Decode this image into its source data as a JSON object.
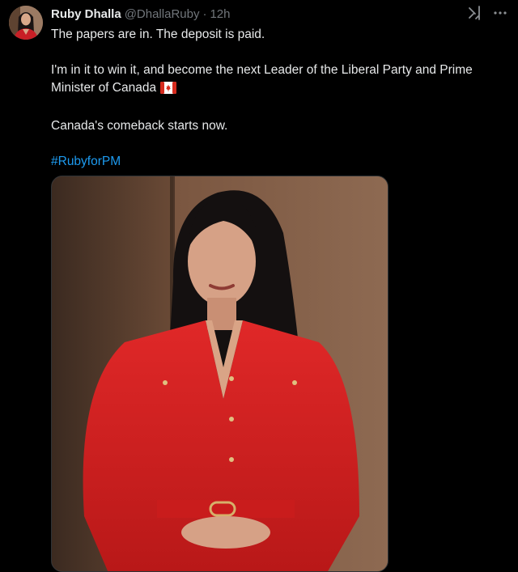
{
  "tweet": {
    "author": {
      "display_name": "Ruby Dhalla",
      "handle": "@DhallaRuby",
      "separator": "·",
      "time": "12h",
      "avatar_icon": "user-avatar"
    },
    "lines": [
      "The papers are in. The deposit is paid.",
      "I'm in it to win it, and become the next Leader of the Liberal Party and Prime Minister of Canada",
      "Canada's comeback starts now."
    ],
    "flag_icon": "canada-flag-emoji",
    "hashtag": "#RubyforPM",
    "top_icons": [
      "grok-icon",
      "more-icon"
    ],
    "media": {
      "type": "photo",
      "icon": "photo-portrait"
    }
  },
  "colors": {
    "background": "#000000",
    "text": "#e7e9ea",
    "muted": "#71767b",
    "link": "#1d9bf0",
    "accent_red": "#d42a2a"
  }
}
